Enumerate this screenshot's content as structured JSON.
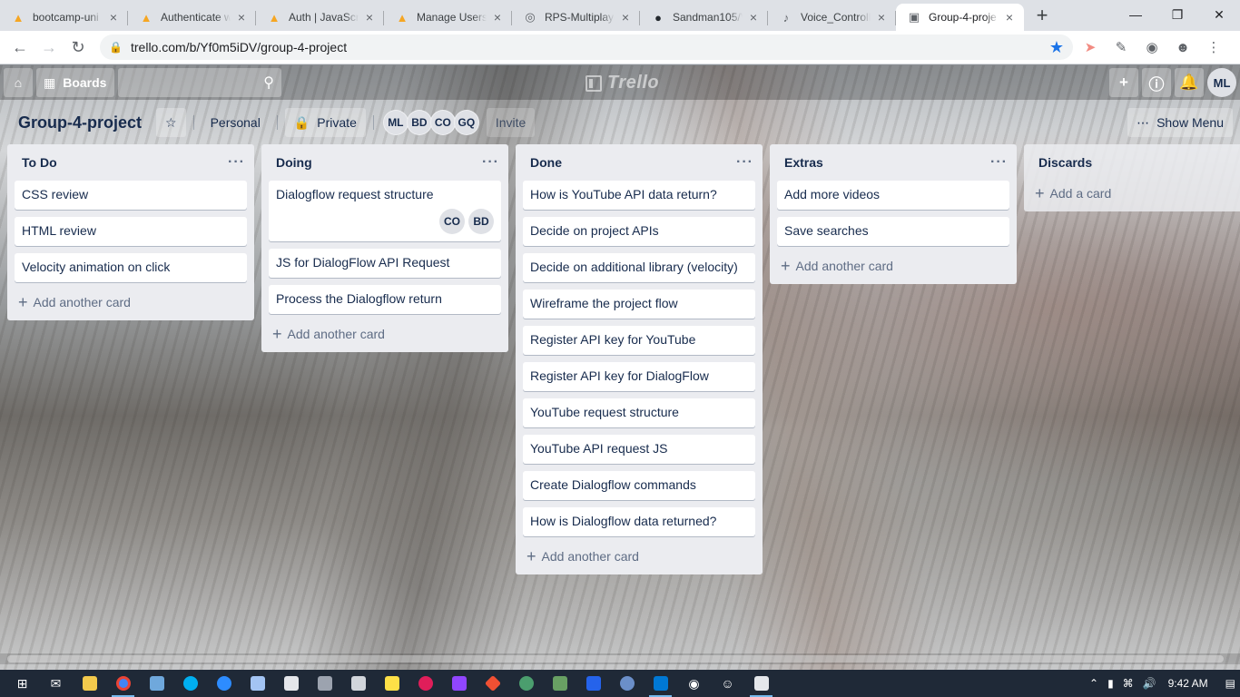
{
  "browser": {
    "tabs": [
      {
        "title": "bootcamp-uni",
        "icon": "firebase-icon",
        "color": "#f5a623",
        "active": false
      },
      {
        "title": "Authenticate w",
        "icon": "firebase-icon",
        "color": "#f5a623",
        "active": false
      },
      {
        "title": "Auth | JavaScri",
        "icon": "firebase-icon",
        "color": "#f5a623",
        "active": false
      },
      {
        "title": "Manage Users",
        "icon": "firebase-icon",
        "color": "#f5a623",
        "active": false
      },
      {
        "title": "RPS-Multiplaye",
        "icon": "globe-icon",
        "color": "#5f6368",
        "active": false
      },
      {
        "title": "Sandman105/V",
        "icon": "github-icon",
        "color": "#24292e",
        "active": false
      },
      {
        "title": "Voice_Controll",
        "icon": "microphone-icon",
        "color": "#5f6368",
        "active": false
      },
      {
        "title": "Group-4-proje",
        "icon": "trello-icon",
        "color": "#5f6368",
        "active": true
      }
    ],
    "new_tab": "+",
    "url": "trello.com/b/Yf0m5iDV/group-4-project"
  },
  "trello": {
    "logo": "Trello",
    "boards_label": "Boards",
    "user_initials": "ML",
    "board": {
      "title": "Group-4-project",
      "team": "Personal",
      "visibility": "Private",
      "members": [
        "ML",
        "BD",
        "CO",
        "GQ"
      ],
      "invite": "Invite",
      "show_menu": "Show Menu"
    },
    "lists": [
      {
        "name": "To Do",
        "cards": [
          {
            "title": "CSS review"
          },
          {
            "title": "HTML review"
          },
          {
            "title": "Velocity animation on click"
          }
        ],
        "add_label": "Add another card"
      },
      {
        "name": "Doing",
        "cards": [
          {
            "title": "Dialogflow request structure",
            "members": [
              "CO",
              "BD"
            ]
          },
          {
            "title": "JS for DialogFlow API Request"
          },
          {
            "title": "Process the Dialogflow return"
          }
        ],
        "add_label": "Add another card"
      },
      {
        "name": "Done",
        "cards": [
          {
            "title": "How is YouTube API data return?"
          },
          {
            "title": "Decide on project APIs"
          },
          {
            "title": "Decide on additional library (velocity)"
          },
          {
            "title": "Wireframe the project flow"
          },
          {
            "title": "Register API key for YouTube"
          },
          {
            "title": "Register API key for DialogFlow"
          },
          {
            "title": "YouTube request structure"
          },
          {
            "title": "YouTube API request JS"
          },
          {
            "title": "Create Dialogflow commands"
          },
          {
            "title": "How is Dialogflow data returned?"
          }
        ],
        "add_label": "Add another card"
      },
      {
        "name": "Extras",
        "cards": [
          {
            "title": "Add more videos"
          },
          {
            "title": "Save searches"
          }
        ],
        "add_label": "Add another card"
      },
      {
        "name": "Discards",
        "cards": [],
        "add_label": "Add a card"
      }
    ]
  },
  "taskbar": {
    "time": "9:42 AM"
  }
}
